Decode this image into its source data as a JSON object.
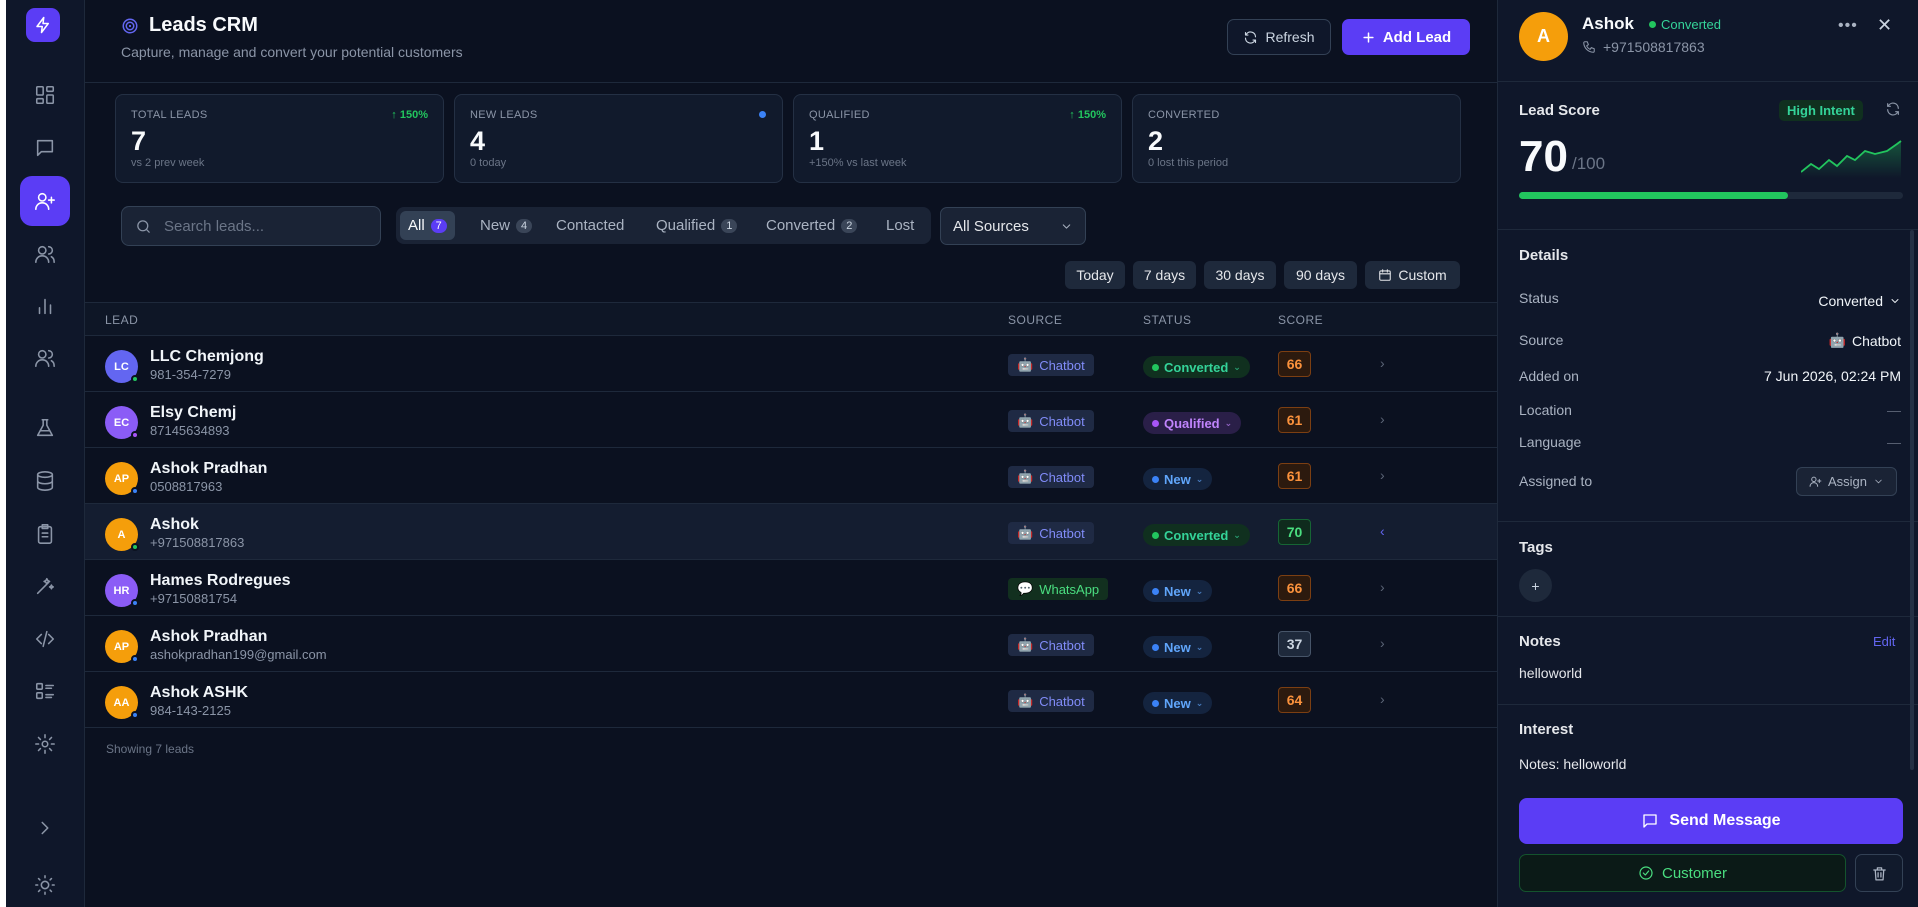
{
  "header": {
    "title": "Leads CRM",
    "subtitle": "Capture, manage and convert your potential customers",
    "refresh_label": "Refresh",
    "add_label": "Add Lead"
  },
  "sidebar": {
    "icons": [
      "bolt-icon",
      "dashboard-icon",
      "chat-icon",
      "user-plus-icon",
      "users-icon",
      "bar-chart-icon",
      "team-icon",
      "flask-icon",
      "database-icon",
      "clipboard-icon",
      "magic-wand-icon",
      "code-icon",
      "list-icon",
      "gear-icon",
      "chevron-right-icon",
      "sun-icon"
    ],
    "active": "user-plus-icon"
  },
  "stats": [
    {
      "label": "TOTAL LEADS",
      "value": "7",
      "sub": "vs 2 prev week",
      "trend": "↑ 150%"
    },
    {
      "label": "NEW LEADS",
      "value": "4",
      "sub": "0 today",
      "trend": ""
    },
    {
      "label": "QUALIFIED",
      "value": "1",
      "sub": "+150% vs last week",
      "trend": "↑ 150%"
    },
    {
      "label": "CONVERTED",
      "value": "2",
      "sub": "0 lost this period",
      "trend": ""
    }
  ],
  "filters": {
    "search_placeholder": "Search leads...",
    "tabs": [
      {
        "label": "All",
        "count": "7"
      },
      {
        "label": "New",
        "count": "4"
      },
      {
        "label": "Contacted",
        "count": ""
      },
      {
        "label": "Qualified",
        "count": "1"
      },
      {
        "label": "Converted",
        "count": "2"
      },
      {
        "label": "Lost",
        "count": ""
      }
    ],
    "active_tab": "All",
    "source_select": "All Sources",
    "ranges": [
      "Today",
      "7 days",
      "30 days",
      "90 days",
      "Custom"
    ]
  },
  "table": {
    "columns": [
      "LEAD",
      "SOURCE",
      "STATUS",
      "SCORE"
    ],
    "rows": [
      {
        "initials": "LC",
        "name": "LLC Chemjong",
        "contact": "981-354-7279",
        "source": "Chatbot",
        "status": "Converted",
        "score": "66"
      },
      {
        "initials": "EC",
        "name": "Elsy Chemj",
        "contact": "87145634893",
        "source": "Chatbot",
        "status": "Qualified",
        "score": "61"
      },
      {
        "initials": "AP",
        "name": "Ashok Pradhan",
        "contact": "0508817963",
        "source": "Chatbot",
        "status": "New",
        "score": "61"
      },
      {
        "initials": "A",
        "name": "Ashok",
        "contact": "+971508817863",
        "source": "Chatbot",
        "status": "Converted",
        "score": "70"
      },
      {
        "initials": "HR",
        "name": "Hames Rodregues",
        "contact": "+97150881754",
        "source": "WhatsApp",
        "status": "New",
        "score": "66"
      },
      {
        "initials": "AP",
        "name": "Ashok Pradhan",
        "contact": "ashokpradhan199@gmail.com",
        "source": "Chatbot",
        "status": "New",
        "score": "37"
      },
      {
        "initials": "AA",
        "name": "Ashok ASHK",
        "contact": "984-143-2125",
        "source": "Chatbot",
        "status": "New",
        "score": "64"
      }
    ],
    "footer": "Showing 7 leads"
  },
  "panel": {
    "initial": "A",
    "name": "Ashok",
    "status": "Converted",
    "phone": "+971508817863",
    "lead_score_title": "Lead Score",
    "intent": "High Intent",
    "score": "70",
    "score_max": "/100",
    "score_fraction": 0.7,
    "details_title": "Details",
    "details": {
      "status_label": "Status",
      "status_value": "Converted",
      "source_label": "Source",
      "source_value": "Chatbot",
      "added_label": "Added on",
      "added_value": "7 Jun 2026, 02:24 PM",
      "location_label": "Location",
      "location_value": "—",
      "language_label": "Language",
      "language_value": "—",
      "assigned_label": "Assigned to",
      "assign_button": "Assign"
    },
    "tags_title": "Tags",
    "tag_add": "+",
    "notes_title": "Notes",
    "notes_edit": "Edit",
    "notes_text": "helloworld",
    "interest_title": "Interest",
    "interest_text": "Notes: helloworld",
    "send_label": "Send Message",
    "customer_label": "Customer"
  },
  "colors": {
    "accent": "#5b3df5",
    "background": "#0b1120",
    "success": "#22c55e",
    "warning": "#fb923c"
  }
}
